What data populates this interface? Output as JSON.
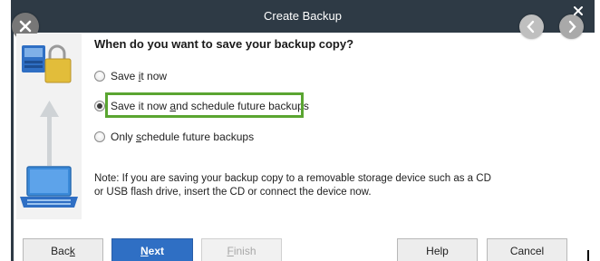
{
  "dialog": {
    "title": "Create Backup"
  },
  "question": "When do you want to save your backup copy?",
  "options": [
    {
      "before": "Save ",
      "underlined": "i",
      "after": "t now",
      "selected": false
    },
    {
      "before": "Save it now ",
      "underlined": "a",
      "after": "nd schedule future backups",
      "selected": true
    },
    {
      "before": "Only ",
      "underlined": "s",
      "after": "chedule future backups",
      "selected": false
    }
  ],
  "note": "Note: If you are saving your backup copy to a removable storage device such as a CD or USB flash drive, insert the CD or connect the device now.",
  "buttons": {
    "back": {
      "before": "Bac",
      "underlined": "k",
      "after": ""
    },
    "next": {
      "before": "",
      "underlined": "N",
      "after": "ext"
    },
    "finish": {
      "before": "",
      "underlined": "F",
      "after": "inish"
    },
    "help": "Help",
    "cancel": "Cancel"
  },
  "icons": {
    "close": "close-icon",
    "prev": "chevron-left-icon",
    "next": "chevron-right-icon",
    "illustration": [
      "server-lock-icon",
      "arrow-up-icon",
      "laptop-icon"
    ]
  },
  "colors": {
    "titlebar": "#2e3a45",
    "highlight": "#5aa531",
    "primary_button": "#2f6fc4"
  }
}
